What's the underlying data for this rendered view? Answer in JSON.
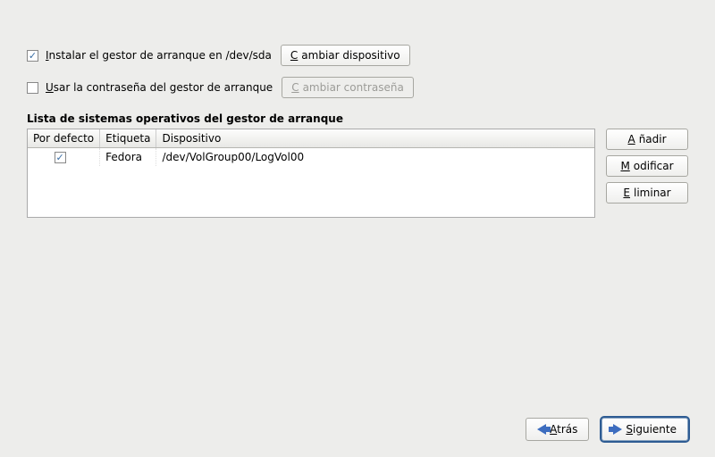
{
  "options": {
    "install_bootloader": {
      "checked": true,
      "label_pre": "I",
      "label_rest": "nstalar el gestor de arranque en /dev/sda",
      "btn_pre": "C",
      "btn_rest": "ambiar dispositivo"
    },
    "use_password": {
      "checked": false,
      "label_pre": "U",
      "label_rest": "sar la contraseña del gestor de arranque",
      "btn_pre": "C",
      "btn_rest": "ambiar contraseña"
    }
  },
  "list": {
    "title": "Lista de sistemas operativos del gestor de arranque",
    "headers": {
      "default": "Por defecto",
      "label": "Etiqueta",
      "device": "Dispositivo"
    },
    "rows": [
      {
        "default": true,
        "label": "Fedora",
        "device": "/dev/VolGroup00/LogVol00"
      }
    ]
  },
  "side": {
    "add_pre": "A",
    "add_rest": "ñadir",
    "mod_pre": "M",
    "mod_rest": "odificar",
    "del_pre": "E",
    "del_rest": "liminar"
  },
  "nav": {
    "back_pre": "A",
    "back_rest": "trás",
    "next_pre": "S",
    "next_rest": "iguiente"
  }
}
